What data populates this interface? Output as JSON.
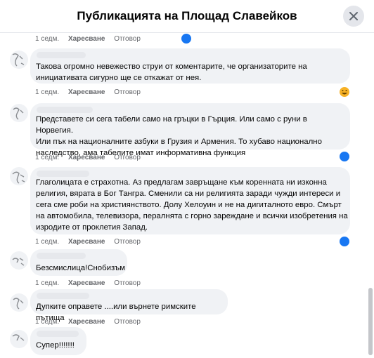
{
  "header": {
    "title": "Публикацията на Площад Славейков"
  },
  "comments": [
    {
      "text": "",
      "time": "1 седм.",
      "like": "Харесване",
      "reply": "Отговор"
    },
    {
      "text": "Такова огромно невежество струи от коментарите, че организаторите на\nинициативата сигурно ще се откажат от нея.",
      "time": "1 седм.",
      "like": "Харесване",
      "reply": "Отговор"
    },
    {
      "text": "Представете си сега табели само на гръцки в Гърция. Или само с руни в Норвегия.\nИли пък на националните азбуки в Грузия и Армения. То хубаво национално\nнаследство, ама табелите имат информативна функция",
      "time": "1 седм.",
      "like": "Харесване",
      "reply": "Отговор"
    },
    {
      "text": "Глаголицата е страхотна. Аз предлагам завръщане към коренната ни изконна\nрелигия, вярата в Бог Тангра. Сменили са ни религията заради чужди интереси и\nсега сме роби на християнството. Долу Хелоуин и не на дигиталното евро. Смърт\nна автомобила, телевизора, пералнята с горно зареждане и всички изобретения на\nизродите от проклетия Запад.",
      "time": "1 седм.",
      "like": "Харесване",
      "reply": "Отговор"
    },
    {
      "text": "Безсмислица!Снобизъм",
      "time": "1 седм.",
      "like": "Харесване",
      "reply": "Отговор"
    },
    {
      "text": "Дупките оправете ....или върнете римските пътища",
      "time": "1 седм.",
      "like": "Харесване",
      "reply": "Отговор"
    },
    {
      "text": "Супер!!!!!!!",
      "time": "",
      "like": "",
      "reply": ""
    }
  ],
  "icons": {
    "close": "close-icon",
    "like_reaction": "like-reaction-icon",
    "haha_reaction": "haha-reaction-icon"
  },
  "colors": {
    "accent": "#1877f2",
    "bubble": "#f0f2f5",
    "meta": "#65676b"
  }
}
